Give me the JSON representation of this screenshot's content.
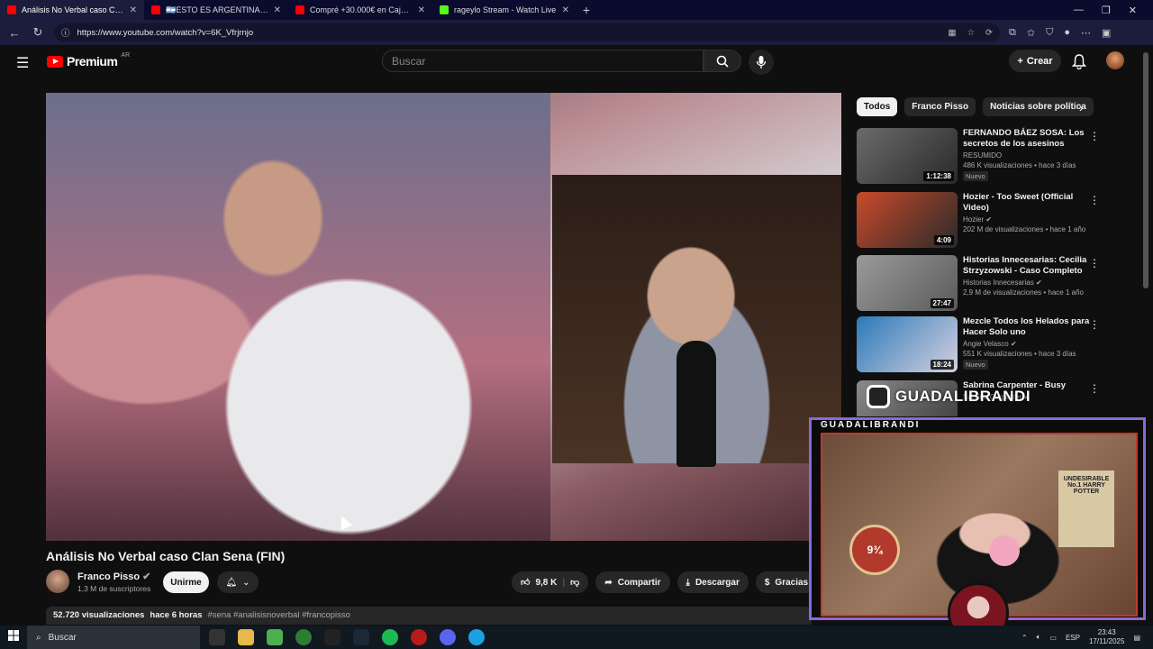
{
  "browser": {
    "tabs": [
      {
        "title": "Análisis No Verbal caso Clan",
        "active": true,
        "fav": "#ff0000"
      },
      {
        "title": "🇦🇷ESTO ES ARGENTINA! MEJO",
        "active": false,
        "fav": "#ff0000"
      },
      {
        "title": "Compré +30.000€ en Cajas Miste",
        "active": false,
        "fav": "#ff0000"
      },
      {
        "title": "rageylo Stream - Watch Live",
        "active": false,
        "fav": "#53fc18"
      }
    ],
    "url": "https://www.youtube.com/watch?v=6K_Vfrjrnjo"
  },
  "header": {
    "logo": "Premium",
    "country": "AR",
    "search_placeholder": "Buscar",
    "create_label": "Crear"
  },
  "video": {
    "title": "Análisis No Verbal caso Clan Sena (FIN)",
    "channel": "Franco Pisso",
    "subscribers": "1,3 M de suscriptores",
    "join_label": "Unirme",
    "likes": "9,8 K",
    "share_label": "Compartir",
    "download_label": "Descargar",
    "thanks_label": "Gracias",
    "views": "52.720 visualizaciones",
    "age": "hace 6 horas",
    "hashtags": "#sena #analisisnoverbal #francopisso"
  },
  "chips": [
    "Todos",
    "Franco Pisso",
    "Noticias sobre política"
  ],
  "recommendations": [
    {
      "title": "FERNANDO BÁEZ SOSA: Los secretos de los asesinos",
      "channel": "RESUMIDO",
      "meta": "486 K visualizaciones • hace 3 días",
      "duration": "1:12:38",
      "badge": "Nuevo",
      "colors": [
        "#6a6a6a",
        "#2a2a2a"
      ]
    },
    {
      "title": "Hozier - Too Sweet (Official Video)",
      "channel": "Hozier",
      "meta": "202 M de visualizaciones • hace 1 año",
      "duration": "4:09",
      "badge": "",
      "colors": [
        "#c94a2a",
        "#2a2a2a"
      ]
    },
    {
      "title": "Historias Innecesarias: Cecilia Strzyzowski - Caso Completo",
      "channel": "Historias Innecesarias",
      "meta": "2,9 M de visualizaciones • hace 1 año",
      "duration": "27:47",
      "badge": "",
      "colors": [
        "#9a9a9a",
        "#5a5a5a"
      ]
    },
    {
      "title": "Mezcle Todos los Helados para Hacer Solo uno",
      "channel": "Angie Velasco",
      "meta": "551 K visualizaciones • hace 3 días",
      "duration": "18:24",
      "badge": "Nuevo",
      "colors": [
        "#2a7ab8",
        "#d6d0e0"
      ]
    },
    {
      "title": "Sabrina Carpenter - Busy",
      "channel": "Sabrina Carpenter",
      "meta": "",
      "duration": "",
      "badge": "",
      "colors": [
        "#8a8a8a",
        "#3a3a3a"
      ]
    }
  ],
  "overlay": {
    "name": "GUADALIBRANDI",
    "ig_handle": "GUADALIBRANDI",
    "sign_text": "UNDESIRABLE No.1 HARRY POTTER",
    "platform": "9¾"
  },
  "taskbar": {
    "search": "Buscar",
    "lang": "ESP",
    "time": "23:43",
    "date": "17/11/2025"
  }
}
